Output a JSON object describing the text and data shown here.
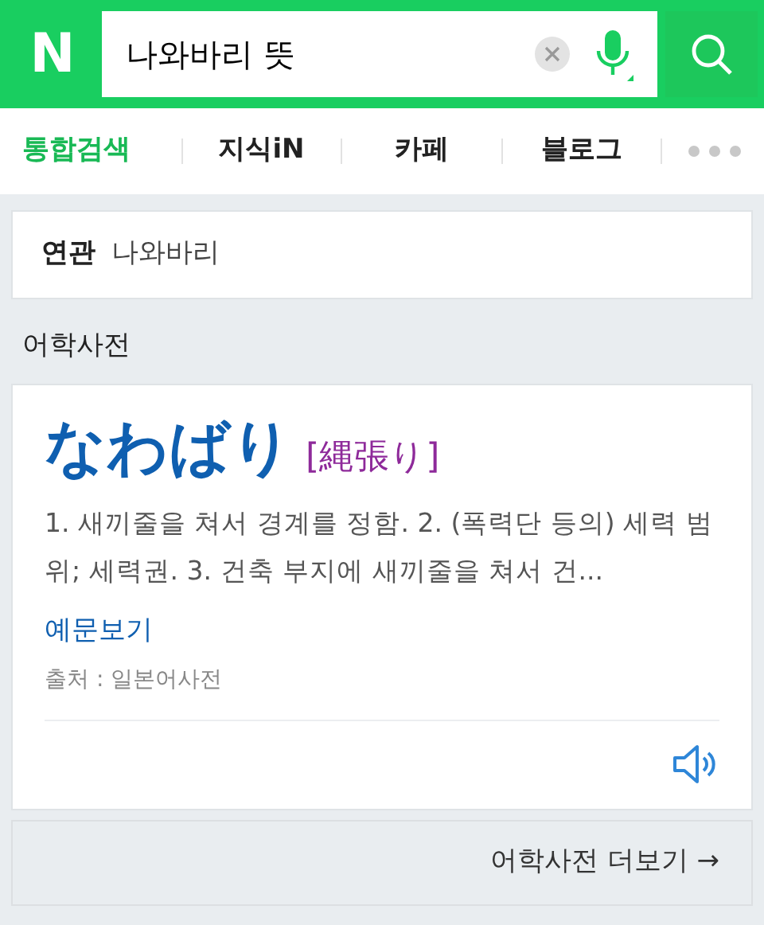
{
  "header": {
    "logo": "N",
    "search": {
      "value": "나와바리 뜻"
    }
  },
  "tabs": [
    {
      "label": "통합검색",
      "selected": true
    },
    {
      "label": "지식iN",
      "selected": false
    },
    {
      "label": "카페",
      "selected": false
    },
    {
      "label": "블로그",
      "selected": false
    }
  ],
  "related": {
    "label": "연관",
    "term": "나와바리"
  },
  "section_title": "어학사전",
  "entry": {
    "word": "なわばり",
    "kanji": "[縄張り]",
    "definition": "1. 새끼줄을 쳐서 경계를 정함. 2. (폭력단 등의) 세력 범위; 세력권. 3. 건축 부지에 새끼줄을 쳐서 건...",
    "examples_link": "예문보기",
    "source": "출처 : 일본어사전"
  },
  "more_link": "어학사전 더보기 →"
}
